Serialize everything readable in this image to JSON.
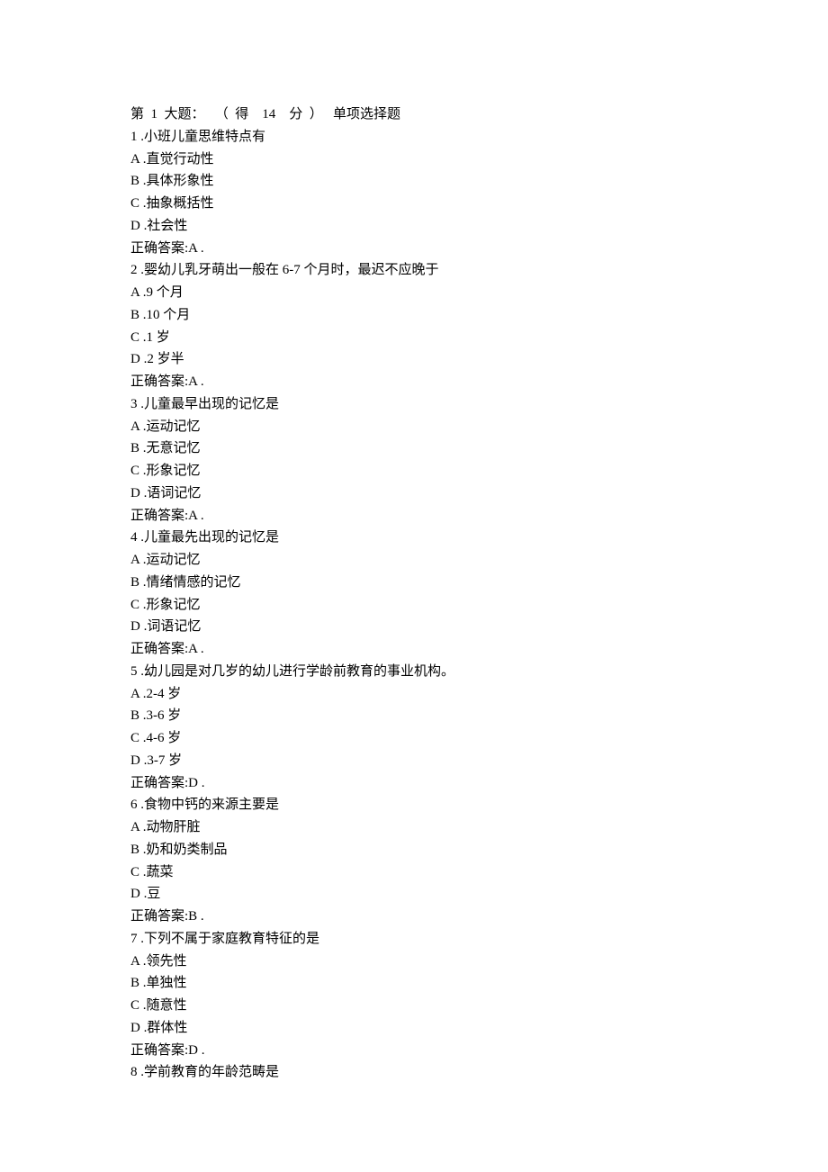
{
  "section": {
    "prefix": "第  1  大题：   （  得    14    分  ）   单项选择题"
  },
  "questions": [
    {
      "num": "1",
      "stem": ".小班儿童思维特点有",
      "options": [
        "A .直觉行动性",
        "B .具体形象性",
        "C .抽象概括性",
        "D .社会性"
      ],
      "answer": "正确答案:A ."
    },
    {
      "num": "2",
      "stem": ".婴幼儿乳牙萌出一般在 6-7 个月时，最迟不应晚于",
      "options": [
        "A .9 个月",
        "B .10 个月",
        "C .1 岁",
        "D .2 岁半"
      ],
      "answer": "正确答案:A ."
    },
    {
      "num": "3",
      "stem": ".儿童最早出现的记忆是",
      "options": [
        "A .运动记忆",
        "B .无意记忆",
        "C .形象记忆",
        "D .语词记忆"
      ],
      "answer": "正确答案:A ."
    },
    {
      "num": "4",
      "stem": ".儿童最先出现的记忆是",
      "options": [
        "A .运动记忆",
        "B .情绪情感的记忆",
        "C .形象记忆",
        "D .词语记忆"
      ],
      "answer": "正确答案:A ."
    },
    {
      "num": "5",
      "stem": ".幼儿园是对几岁的幼儿进行学龄前教育的事业机构。",
      "options": [
        "A .2-4 岁",
        "B .3-6 岁",
        "C .4-6 岁",
        "D .3-7 岁"
      ],
      "answer": "正确答案:D ."
    },
    {
      "num": "6",
      "stem": ".食物中钙的来源主要是",
      "options": [
        "A .动物肝脏",
        "B .奶和奶类制品",
        "C .蔬菜",
        "D .豆"
      ],
      "answer": "正确答案:B ."
    },
    {
      "num": "7",
      "stem": ".下列不属于家庭教育特征的是",
      "options": [
        "A .领先性",
        "B .单独性",
        "C .随意性",
        "D .群体性"
      ],
      "answer": "正确答案:D ."
    },
    {
      "num": "8",
      "stem": ".学前教育的年龄范畴是",
      "options": [],
      "answer": null
    }
  ]
}
